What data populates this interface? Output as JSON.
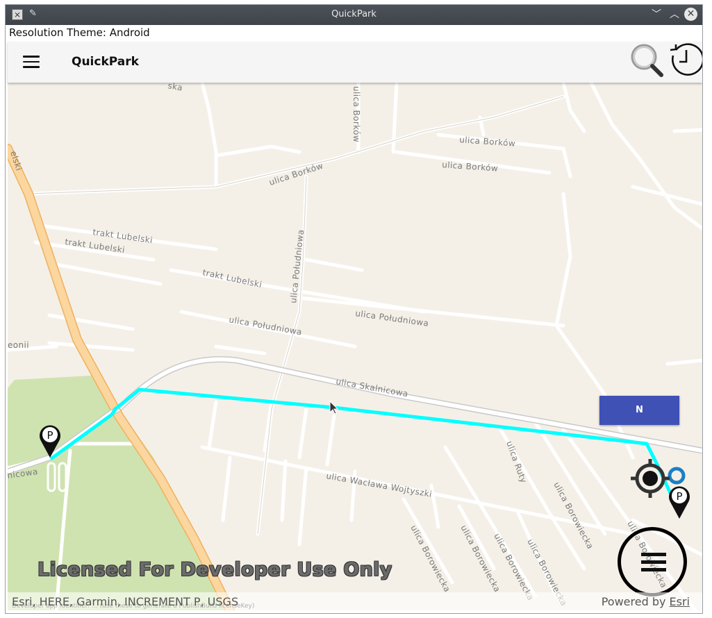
{
  "window": {
    "title": "QuickPark",
    "controls": {
      "minimize": "﹀",
      "maximize": "︿",
      "close": "✕"
    }
  },
  "resolution_theme": "Resolution Theme: Android",
  "appbar": {
    "title": "QuickPark",
    "menu_icon": "hamburger-icon",
    "search_icon": "search-icon",
    "history_icon": "history-icon"
  },
  "map": {
    "street_labels": {
      "borkow_1": "ulica Borków",
      "borkow_2": "ulica Borków",
      "borkow_3": "ulica Borków",
      "borkow_vertical": "ulica Borków",
      "lubelski_1": "trakt Lubelski",
      "lubelski_2": "trakt Lubelski",
      "lubelski_3": "trakt Lubelski",
      "poludniowa_vertical": "ulica Południowa",
      "poludniowa_1": "ulica Południowa",
      "poludniowa_2": "ulica Południowa",
      "skalnicowa": "ulica Skalnicowa",
      "wojtyszki": "ulica Wacława Wojtyszki",
      "ruty": "ulica Ruty",
      "borowiecka_1": "ulica Borowiecka",
      "borowiecka_2": "ulica Borowiecka",
      "borowiecka_3": "ulica Borowiecka",
      "borowiecka_4": "ulica Borowiecka",
      "borowiecka_5": "ulica Borowiecka",
      "borowiecka_6": "ulica Borowiecka",
      "lelski": "elski",
      "ronii": "eonii",
      "nicowa": "nicowa",
      "ska": "ska"
    },
    "direction_label": "N",
    "licensed_text": "Licensed For Developer Use Only",
    "attribution": "Esri, HERE, Garmin, INCREMENT P, USGS",
    "developer_note": "Developer app identifier: ... (use these to generate a PublishBuild licenseKey)",
    "powered_by": "Powered by ",
    "powered_link": "Esri",
    "parking_pin_letter": "P",
    "colors": {
      "background": "#f4f0e8",
      "park": "#cfe3b0",
      "highway": "#fbd69f",
      "route": "#00ffff",
      "direction_box": "#3f51b5"
    }
  }
}
